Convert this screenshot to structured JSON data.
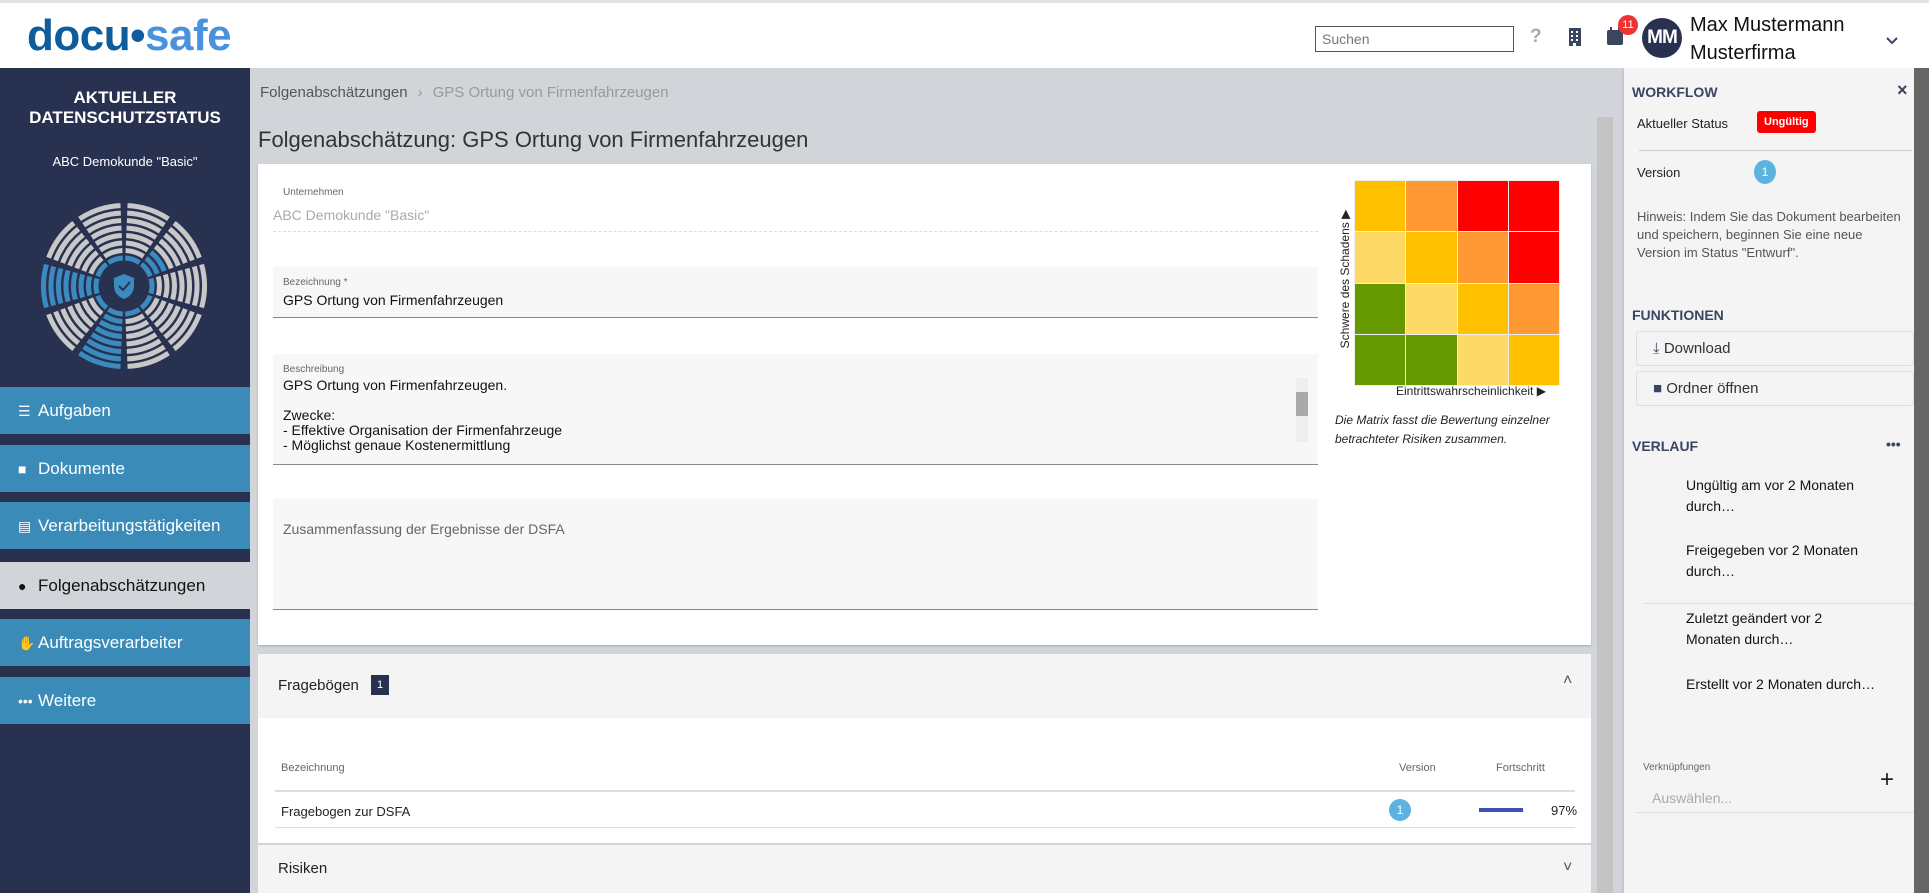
{
  "header": {
    "logo_part1": "docu",
    "logo_part2": "safe",
    "search_placeholder": "Suchen",
    "help_icon": "?",
    "notification_count": "11",
    "avatar_initials": "MM",
    "user_name": "Max Mustermann",
    "company": "Musterfirma"
  },
  "sidebar": {
    "title": "AKTUELLER DATENSCHUTZSTATUS",
    "client": "ABC Demokunde \"Basic\"",
    "status_levels": [
      1,
      3,
      1,
      1,
      1,
      8,
      1,
      8,
      1,
      1
    ],
    "status_colors": {
      "filled": "#3b8bc0",
      "empty": "#c8c8c8"
    },
    "items": [
      {
        "label": "Aufgaben",
        "icon": "tasks-icon"
      },
      {
        "label": "Dokumente",
        "icon": "folder-icon"
      },
      {
        "label": "Verarbeitungstätigkeiten",
        "icon": "file-icon"
      },
      {
        "label": "Folgenabschätzungen",
        "icon": "fire-icon",
        "active": true
      },
      {
        "label": "Auftragsverarbeiter",
        "icon": "handshake-icon"
      },
      {
        "label": "Weitere",
        "icon": "more-icon"
      }
    ]
  },
  "breadcrumb": {
    "parent": "Folgenabschätzungen",
    "current": "GPS Ortung von Firmenfahrzeugen"
  },
  "page_title": "Folgenabschätzung: GPS Ortung von Firmenfahrzeugen",
  "form": {
    "company_label": "Unternehmen",
    "company_value": "ABC Demokunde \"Basic\"",
    "name_label": "Bezeichnung *",
    "name_value": "GPS Ortung von Firmenfahrzeugen",
    "desc_label": "Beschreibung",
    "desc_value": "GPS Ortung von Firmenfahrzeugen.\n\nZwecke:\n- Effektive Organisation der Firmenfahrzeuge\n- Möglichst genaue Kostenermittlung",
    "summary_placeholder": "Zusammenfassung der Ergebnisse der DSFA"
  },
  "matrix": {
    "y_label": "Schwere des Schadens",
    "x_label": "Eintrittswahrscheinlichkeit",
    "caption": "Die Matrix fasst die Bewertung einzelner betrachteter Risiken zusammen.",
    "colors": [
      [
        "#ffc000",
        "#ff9933",
        "#ff0000",
        "#ff0000"
      ],
      [
        "#ffd966",
        "#ffc000",
        "#ff9933",
        "#ff0000"
      ],
      [
        "#669900",
        "#ffd966",
        "#ffc000",
        "#ff9933"
      ],
      [
        "#669900",
        "#669900",
        "#ffd966",
        "#ffc000"
      ]
    ]
  },
  "fragebogen": {
    "title": "Fragebögen",
    "count": "1",
    "col_name": "Bezeichnung",
    "col_version": "Version",
    "col_progress": "Fortschritt",
    "rows": [
      {
        "name": "Fragebogen zur DSFA",
        "version": "1",
        "progress_label": "97%",
        "progress": 97
      }
    ]
  },
  "risiken": {
    "title": "Risiken"
  },
  "workflow": {
    "title": "WORKFLOW",
    "status_label": "Aktueller Status",
    "status_value": "Ungültig",
    "status_color": "#ff0000",
    "version_label": "Version",
    "version_value": "1",
    "hint": "Hinweis: Indem Sie das Dokument bearbeiten und speichern, beginnen Sie eine neue Version im Status \"Entwurf\".",
    "functions_title": "FUNKTIONEN",
    "download": "Download",
    "open_folder": "Ordner öffnen",
    "history_title": "VERLAUF",
    "history": [
      "Ungültig am vor 2 Monaten durch…",
      "Freigegeben vor 2 Monaten durch…",
      "Zuletzt geändert vor 2 Monaten durch…",
      "Erstellt vor 2 Monaten durch…"
    ],
    "links_label": "Verknüpfungen",
    "links_placeholder": "Auswählen..."
  }
}
